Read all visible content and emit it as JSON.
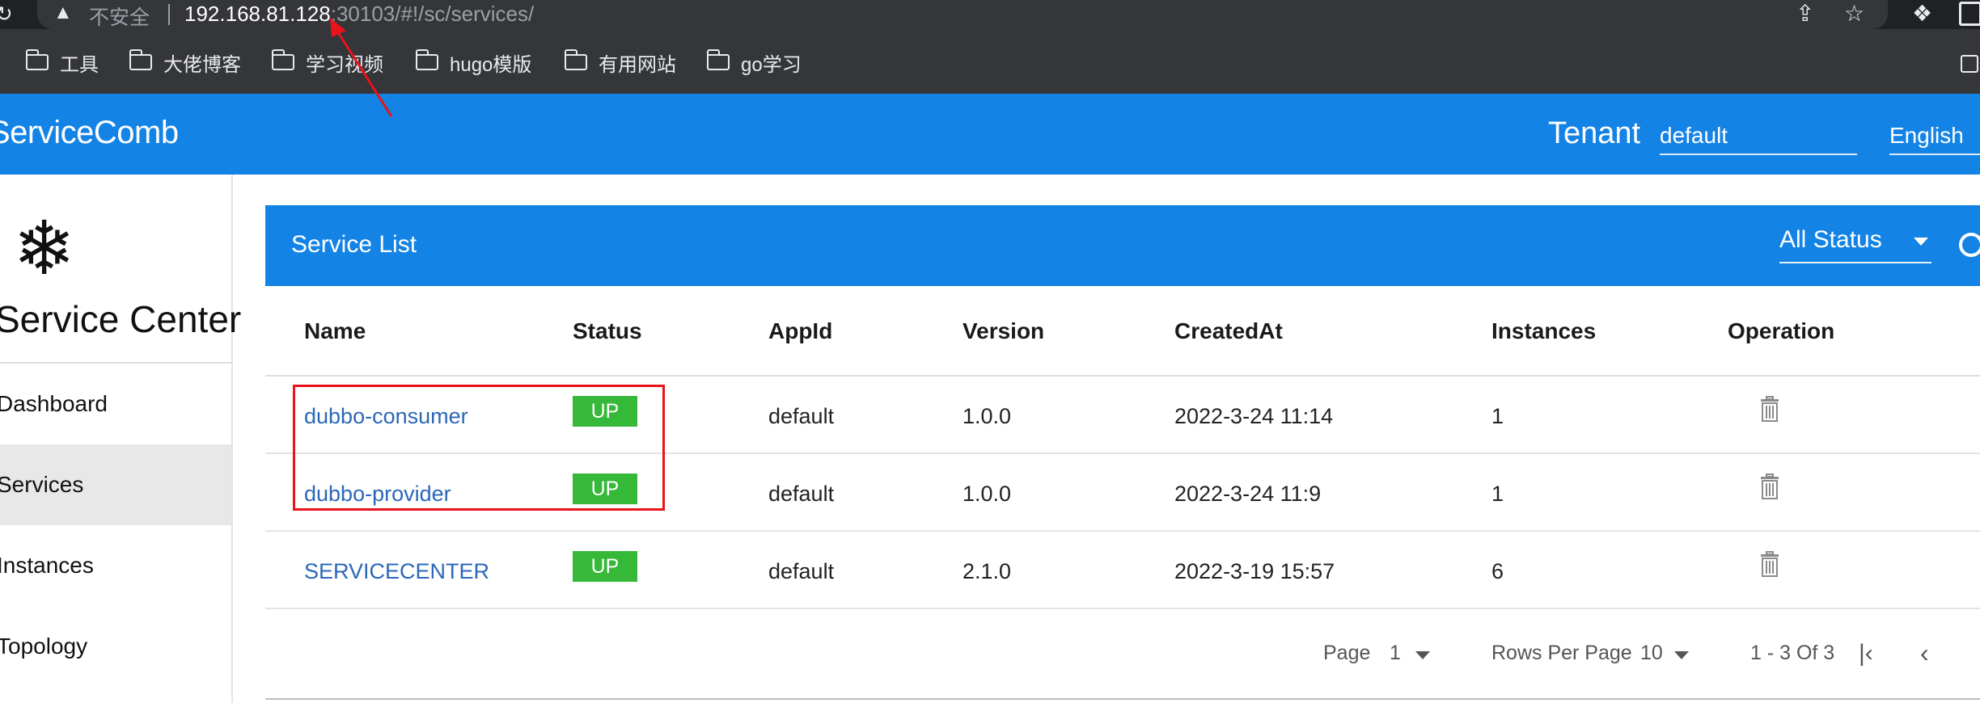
{
  "browser": {
    "insecure_label": "不安全",
    "url_host": "192.168.81.128",
    "url_rest": ":30103/#!/sc/services/",
    "bookmarks": [
      "工具",
      "大佬博客",
      "学习视频",
      "hugo模版",
      "有用网站",
      "go学习"
    ]
  },
  "header": {
    "brand": "ServiceComb",
    "tenant_label": "Tenant",
    "tenant_value": "default",
    "language": "English"
  },
  "sidebar": {
    "title": "Service Center",
    "items": [
      {
        "label": "Dashboard",
        "active": false
      },
      {
        "label": "Services",
        "active": true
      },
      {
        "label": "Instances",
        "active": false
      },
      {
        "label": "Topology",
        "active": false
      }
    ]
  },
  "service_list": {
    "title": "Service List",
    "status_filter": "All Status",
    "columns": [
      "Name",
      "Status",
      "AppId",
      "Version",
      "CreatedAt",
      "Instances",
      "Operation"
    ],
    "rows": [
      {
        "name": "dubbo-consumer",
        "status": "UP",
        "appid": "default",
        "version": "1.0.0",
        "created": "2022-3-24 11:14",
        "instances": "1"
      },
      {
        "name": "dubbo-provider",
        "status": "UP",
        "appid": "default",
        "version": "1.0.0",
        "created": "2022-3-24 11:9",
        "instances": "1"
      },
      {
        "name": "SERVICECENTER",
        "status": "UP",
        "appid": "default",
        "version": "2.1.0",
        "created": "2022-3-19 15:57",
        "instances": "6"
      }
    ]
  },
  "pagination": {
    "page_label": "Page",
    "page": "1",
    "rows_label": "Rows Per Page",
    "rows_per_page": "10",
    "range": "1 - 3 Of 3"
  },
  "colors": {
    "primary": "#1383e5",
    "status_up": "#36b839",
    "link": "#2b67b8",
    "annotation": "#e8131b"
  },
  "icons": [
    "reload-icon",
    "warning-icon",
    "share-icon",
    "star-icon",
    "extension-icon",
    "folder-icon",
    "snowflake-icon",
    "search-icon",
    "trash-icon",
    "first-page-icon",
    "prev-page-icon"
  ]
}
